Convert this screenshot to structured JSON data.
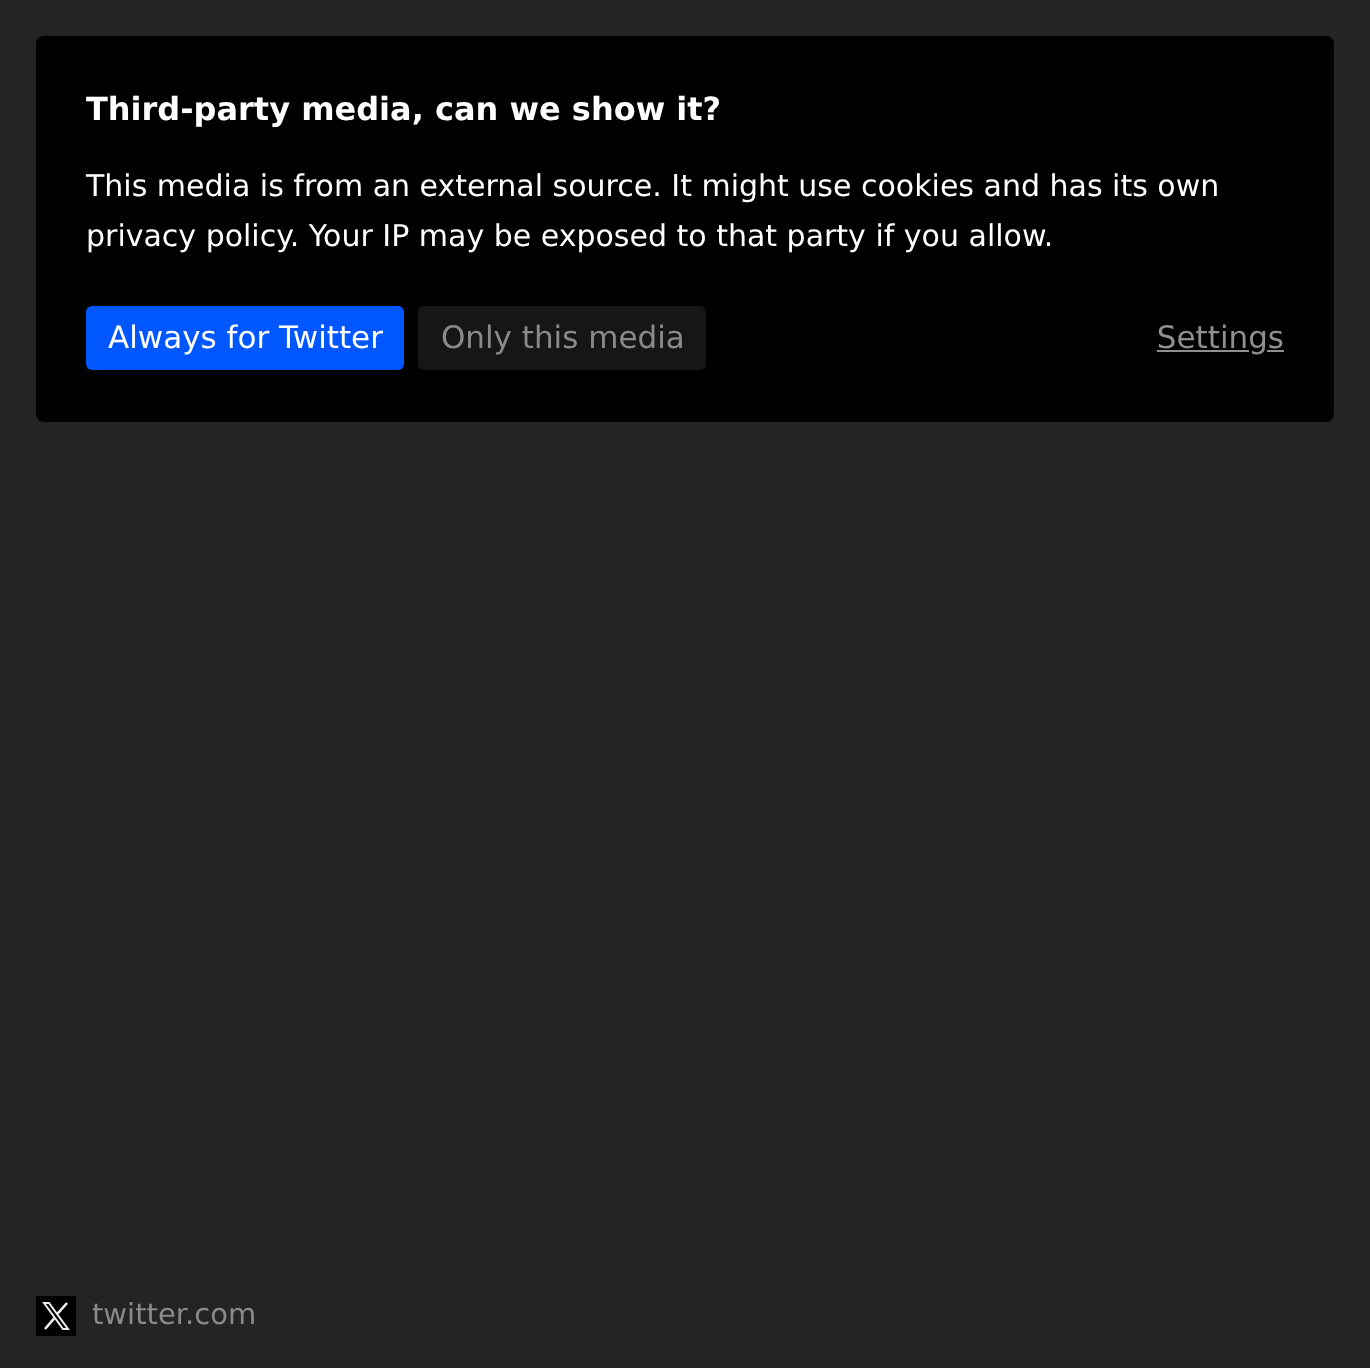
{
  "consent": {
    "title": "Third-party media, can we show it?",
    "message": "This media is from an external source. It might use cookies and has its own privacy policy. Your IP may be exposed to that party if you allow.",
    "buttons": [
      {
        "label": "Always for Twitter",
        "kind": "primary"
      },
      {
        "label": "Only this media",
        "kind": "secondary"
      }
    ],
    "settings_link": "Settings"
  },
  "source": {
    "domain": "twitter.com"
  }
}
